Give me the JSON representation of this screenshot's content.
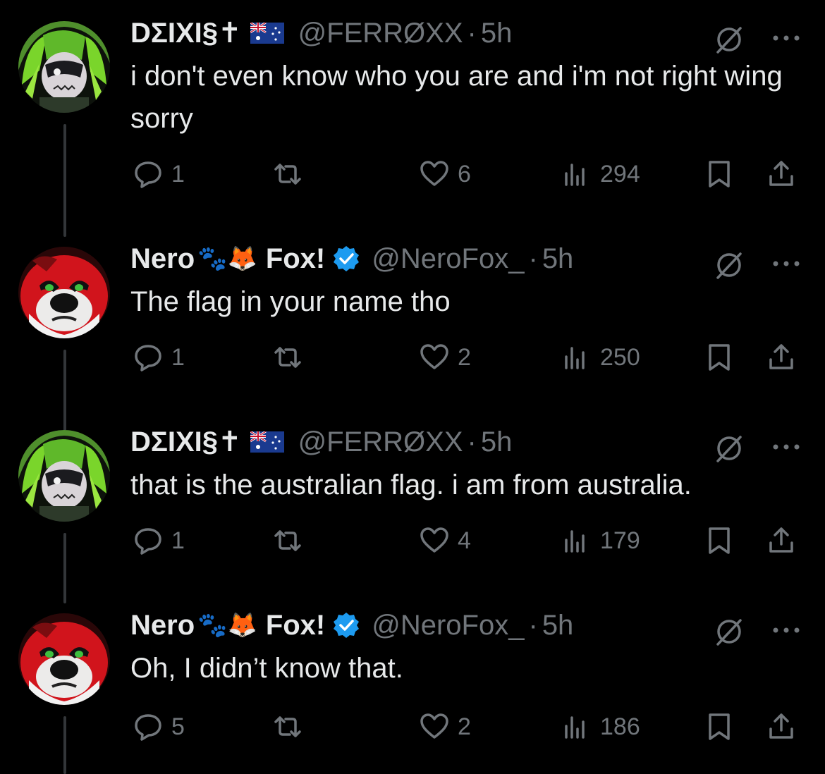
{
  "colors": {
    "background": "#000000",
    "text_primary": "#e7e9ea",
    "text_secondary": "#71767b",
    "verified_blue": "#1d9bf0",
    "thread_line": "#333639"
  },
  "tweets": [
    {
      "display_name": "DΣIXI§✝",
      "emojis": "",
      "has_flag": "australia-flag",
      "verified": false,
      "handle": "@FERRØXX",
      "time": "5h",
      "text": "i don't even know who you are and i'm not right wing sorry",
      "replies": "1",
      "retweets": "",
      "likes": "6",
      "views": "294"
    },
    {
      "display_name": "Nero",
      "emojis": "🐾🦊",
      "display_name_suffix": "Fox!",
      "verified": true,
      "handle": "@NeroFox_",
      "time": "5h",
      "text": "The flag in your name tho",
      "replies": "1",
      "retweets": "",
      "likes": "2",
      "views": "250"
    },
    {
      "display_name": "DΣIXI§✝",
      "emojis": "",
      "has_flag": "australia-flag",
      "verified": false,
      "handle": "@FERRØXX",
      "time": "5h",
      "text": "that is the australian flag. i am from australia.",
      "replies": "1",
      "retweets": "",
      "likes": "4",
      "views": "179"
    },
    {
      "display_name": "Nero",
      "emojis": "🐾🦊",
      "display_name_suffix": "Fox!",
      "verified": true,
      "handle": "@NeroFox_",
      "time": "5h",
      "text": "Oh, I didn’t know that.",
      "replies": "5",
      "retweets": "",
      "likes": "2",
      "views": "186"
    }
  ],
  "separator": "·"
}
